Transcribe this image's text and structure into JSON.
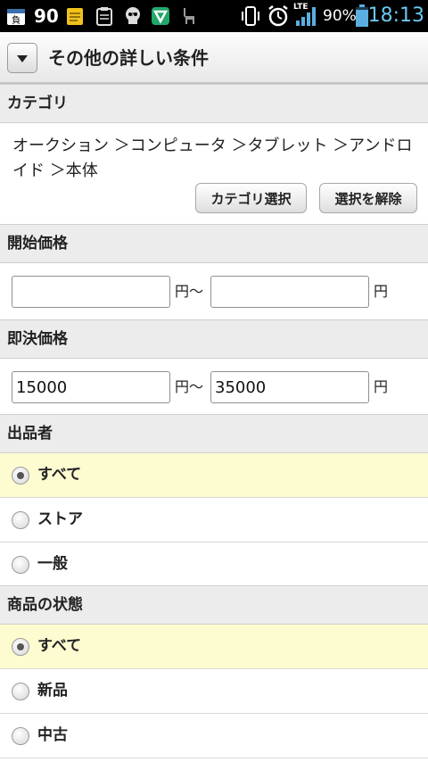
{
  "status_bar": {
    "notification_count": "90",
    "battery_percent": "90%",
    "clock": "18:13",
    "network_label": "LTE",
    "icons": [
      "calendar-icon",
      "notes-icon",
      "clipboard-icon",
      "skull-off-icon",
      "vpn-shield-icon",
      "llama-icon",
      "vibrate-icon",
      "alarm-icon",
      "signal-icon",
      "battery-icon"
    ]
  },
  "header": {
    "title": "その他の詳しい条件",
    "toggle_icon": "chevron-down-icon"
  },
  "category": {
    "heading": "カテゴリ",
    "path": "オークション ＞コンピュータ ＞タブレット ＞アンドロイド ＞本体",
    "select_button": "カテゴリ選択",
    "clear_button": "選択を解除"
  },
  "start_price": {
    "heading": "開始価格",
    "min_value": "",
    "max_value": "",
    "range_unit": "円〜",
    "unit": "円"
  },
  "buyout_price": {
    "heading": "即決価格",
    "min_value": "15000",
    "max_value": "35000",
    "range_unit": "円〜",
    "unit": "円"
  },
  "seller": {
    "heading": "出品者",
    "options": [
      {
        "label": "すべて",
        "selected": true
      },
      {
        "label": "ストア",
        "selected": false
      },
      {
        "label": "一般",
        "selected": false
      }
    ]
  },
  "condition": {
    "heading": "商品の状態",
    "options": [
      {
        "label": "すべて",
        "selected": true
      },
      {
        "label": "新品",
        "selected": false
      },
      {
        "label": "中古",
        "selected": false
      }
    ]
  },
  "colors": {
    "selected_row": "#fdfcd0",
    "section_head": "#ececec",
    "clock": "#6cc7f0"
  }
}
